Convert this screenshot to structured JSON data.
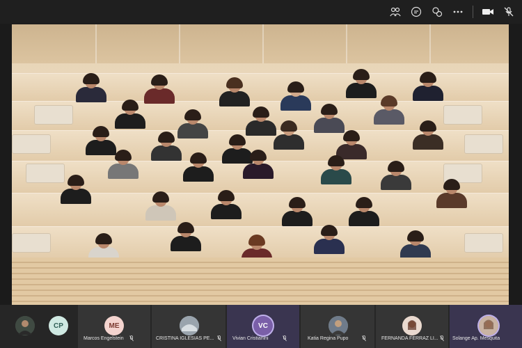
{
  "toolbar": {
    "icons": [
      "people-icon",
      "chat-icon",
      "reactions-icon",
      "more-icon",
      "camera-icon",
      "mic-off-icon"
    ]
  },
  "participants": [
    {
      "initials": "",
      "name": "",
      "avatar_color": "#4a4a4a"
    },
    {
      "initials": "CP",
      "name": "",
      "avatar_color": "#cfe9e2"
    },
    {
      "initials": "ME",
      "name": "Marcos Engelstein",
      "avatar_color": "#f4d4cf"
    },
    {
      "initials": "",
      "name": "CRISTINA IGLESIAS PE...",
      "avatar_color": "#9aa4ad"
    },
    {
      "initials": "VC",
      "name": "Vivian Cristianini",
      "avatar_color": "#7a5fa8"
    },
    {
      "initials": "",
      "name": "Katia Regina Pupo",
      "avatar_color": "#7f8a6a"
    },
    {
      "initials": "",
      "name": "FERNANDA FERRAZ LI...",
      "avatar_color": "#8c6b58"
    },
    {
      "initials": "",
      "name": "Solange Ap. Mesquita",
      "avatar_color": "#a48a7a"
    }
  ],
  "colors": {
    "topbar": "#1f1f1f",
    "bottombar": "#262626",
    "tile": "#353535",
    "active_tile": "#3a3550"
  }
}
